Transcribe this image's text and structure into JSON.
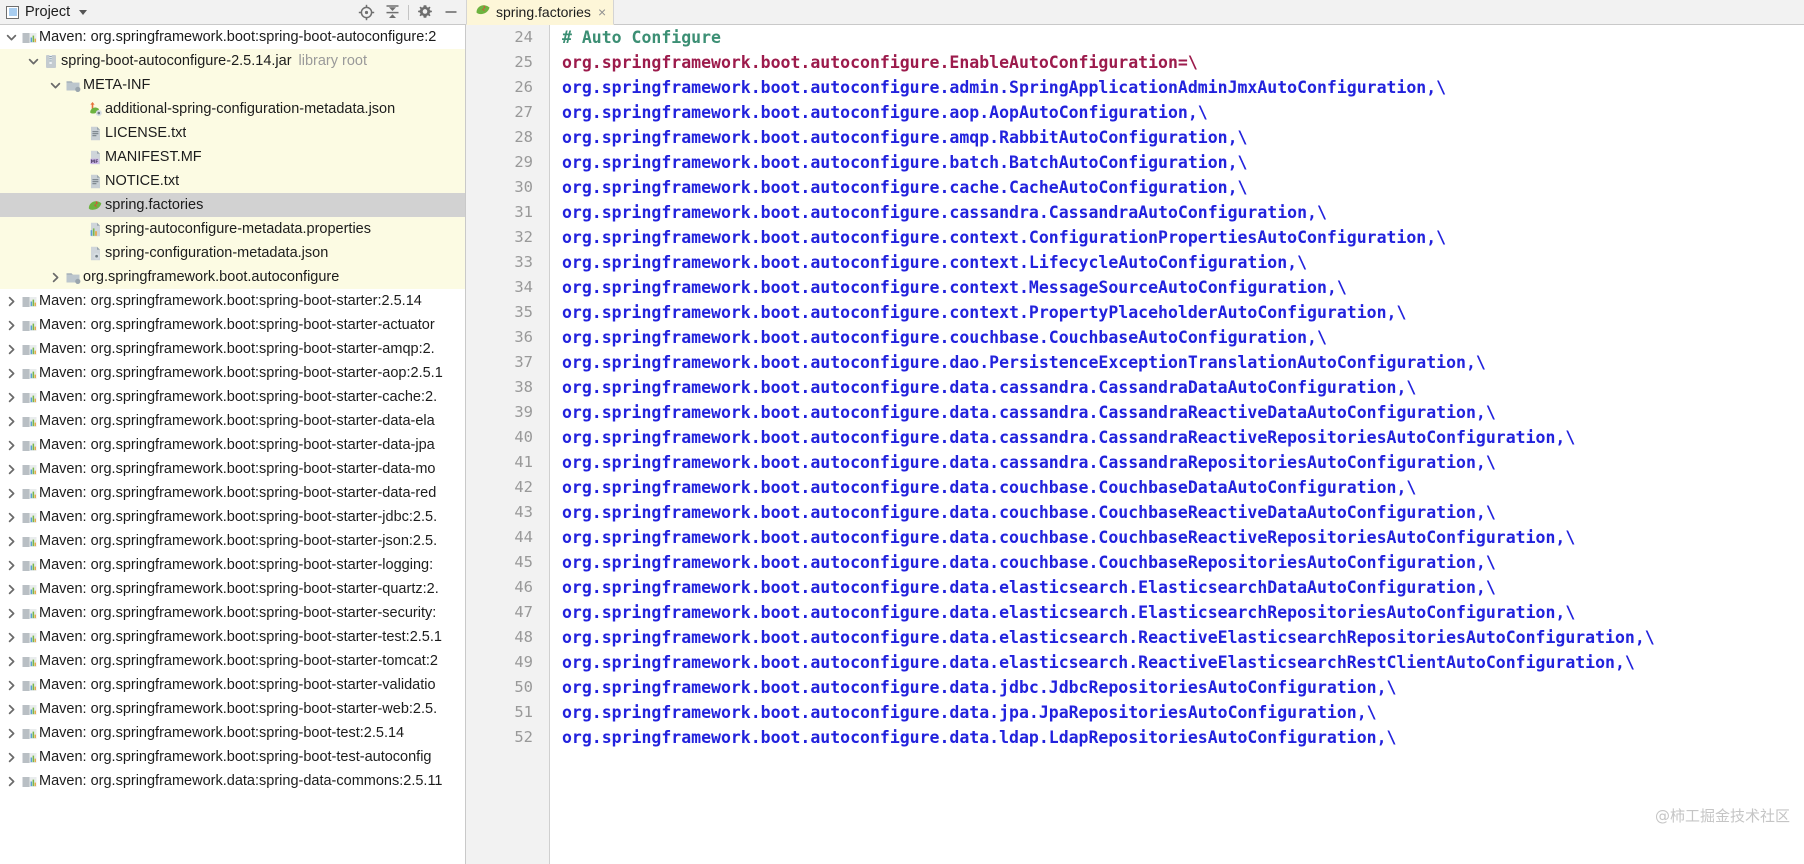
{
  "toolwindow": {
    "title": "Project",
    "dropdown_icon": "chevron-down-icon",
    "panel_icon": "project-panel-icon",
    "actions": [
      {
        "name": "locate-icon",
        "tooltip": "Select Opened File"
      },
      {
        "name": "collapse-all-icon",
        "tooltip": "Collapse All"
      },
      {
        "name": "gear-icon",
        "tooltip": "Settings"
      },
      {
        "name": "hide-icon",
        "tooltip": "Hide"
      }
    ]
  },
  "editor_tabs": [
    {
      "label": "spring.factories",
      "icon": "spring-leaf-icon",
      "close": "×",
      "active": true
    }
  ],
  "tree": [
    {
      "indent": 1,
      "arrow": "down",
      "icon": "maven-icon",
      "label": "Maven: org.springframework.boot:spring-boot-autoconfigure:2",
      "dim": "",
      "state": "normal"
    },
    {
      "indent": 2,
      "arrow": "down",
      "icon": "jar-icon",
      "label": "spring-boot-autoconfigure-2.5.14.jar",
      "dim": "library root",
      "state": "lib"
    },
    {
      "indent": 3,
      "arrow": "down",
      "icon": "folder-icon",
      "label": "META-INF",
      "dim": "",
      "state": "lib"
    },
    {
      "indent": 4,
      "arrow": "none",
      "icon": "spring-config-icon",
      "label": "additional-spring-configuration-metadata.json",
      "dim": "",
      "state": "lib"
    },
    {
      "indent": 4,
      "arrow": "none",
      "icon": "text-file-icon",
      "label": "LICENSE.txt",
      "dim": "",
      "state": "lib"
    },
    {
      "indent": 4,
      "arrow": "none",
      "icon": "manifest-icon",
      "label": "MANIFEST.MF",
      "dim": "",
      "state": "lib"
    },
    {
      "indent": 4,
      "arrow": "none",
      "icon": "text-file-icon",
      "label": "NOTICE.txt",
      "dim": "",
      "state": "lib"
    },
    {
      "indent": 4,
      "arrow": "none",
      "icon": "spring-leaf-icon",
      "label": "spring.factories",
      "dim": "",
      "state": "selected"
    },
    {
      "indent": 4,
      "arrow": "none",
      "icon": "properties-icon",
      "label": "spring-autoconfigure-metadata.properties",
      "dim": "",
      "state": "lib"
    },
    {
      "indent": 4,
      "arrow": "none",
      "icon": "json-icon",
      "label": "spring-configuration-metadata.json",
      "dim": "",
      "state": "lib"
    },
    {
      "indent": 3,
      "arrow": "right",
      "icon": "folder-icon",
      "label": "org.springframework.boot.autoconfigure",
      "dim": "",
      "state": "lib"
    },
    {
      "indent": 1,
      "arrow": "right",
      "icon": "maven-icon",
      "label": "Maven: org.springframework.boot:spring-boot-starter:2.5.14",
      "dim": "",
      "state": "normal"
    },
    {
      "indent": 1,
      "arrow": "right",
      "icon": "maven-icon",
      "label": "Maven: org.springframework.boot:spring-boot-starter-actuator",
      "dim": "",
      "state": "normal"
    },
    {
      "indent": 1,
      "arrow": "right",
      "icon": "maven-icon",
      "label": "Maven: org.springframework.boot:spring-boot-starter-amqp:2.",
      "dim": "",
      "state": "normal"
    },
    {
      "indent": 1,
      "arrow": "right",
      "icon": "maven-icon",
      "label": "Maven: org.springframework.boot:spring-boot-starter-aop:2.5.1",
      "dim": "",
      "state": "normal"
    },
    {
      "indent": 1,
      "arrow": "right",
      "icon": "maven-icon",
      "label": "Maven: org.springframework.boot:spring-boot-starter-cache:2.",
      "dim": "",
      "state": "normal"
    },
    {
      "indent": 1,
      "arrow": "right",
      "icon": "maven-icon",
      "label": "Maven: org.springframework.boot:spring-boot-starter-data-ela",
      "dim": "",
      "state": "normal"
    },
    {
      "indent": 1,
      "arrow": "right",
      "icon": "maven-icon",
      "label": "Maven: org.springframework.boot:spring-boot-starter-data-jpa",
      "dim": "",
      "state": "normal"
    },
    {
      "indent": 1,
      "arrow": "right",
      "icon": "maven-icon",
      "label": "Maven: org.springframework.boot:spring-boot-starter-data-mo",
      "dim": "",
      "state": "normal"
    },
    {
      "indent": 1,
      "arrow": "right",
      "icon": "maven-icon",
      "label": "Maven: org.springframework.boot:spring-boot-starter-data-red",
      "dim": "",
      "state": "normal"
    },
    {
      "indent": 1,
      "arrow": "right",
      "icon": "maven-icon",
      "label": "Maven: org.springframework.boot:spring-boot-starter-jdbc:2.5.",
      "dim": "",
      "state": "normal"
    },
    {
      "indent": 1,
      "arrow": "right",
      "icon": "maven-icon",
      "label": "Maven: org.springframework.boot:spring-boot-starter-json:2.5.",
      "dim": "",
      "state": "normal"
    },
    {
      "indent": 1,
      "arrow": "right",
      "icon": "maven-icon",
      "label": "Maven: org.springframework.boot:spring-boot-starter-logging:",
      "dim": "",
      "state": "normal"
    },
    {
      "indent": 1,
      "arrow": "right",
      "icon": "maven-icon",
      "label": "Maven: org.springframework.boot:spring-boot-starter-quartz:2.",
      "dim": "",
      "state": "normal"
    },
    {
      "indent": 1,
      "arrow": "right",
      "icon": "maven-icon",
      "label": "Maven: org.springframework.boot:spring-boot-starter-security:",
      "dim": "",
      "state": "normal"
    },
    {
      "indent": 1,
      "arrow": "right",
      "icon": "maven-icon",
      "label": "Maven: org.springframework.boot:spring-boot-starter-test:2.5.1",
      "dim": "",
      "state": "normal"
    },
    {
      "indent": 1,
      "arrow": "right",
      "icon": "maven-icon",
      "label": "Maven: org.springframework.boot:spring-boot-starter-tomcat:2",
      "dim": "",
      "state": "normal"
    },
    {
      "indent": 1,
      "arrow": "right",
      "icon": "maven-icon",
      "label": "Maven: org.springframework.boot:spring-boot-starter-validatio",
      "dim": "",
      "state": "normal"
    },
    {
      "indent": 1,
      "arrow": "right",
      "icon": "maven-icon",
      "label": "Maven: org.springframework.boot:spring-boot-starter-web:2.5.",
      "dim": "",
      "state": "normal"
    },
    {
      "indent": 1,
      "arrow": "right",
      "icon": "maven-icon",
      "label": "Maven: org.springframework.boot:spring-boot-test:2.5.14",
      "dim": "",
      "state": "normal"
    },
    {
      "indent": 1,
      "arrow": "right",
      "icon": "maven-icon",
      "label": "Maven: org.springframework.boot:spring-boot-test-autoconfig",
      "dim": "",
      "state": "normal"
    },
    {
      "indent": 1,
      "arrow": "right",
      "icon": "maven-icon",
      "label": "Maven: org.springframework.data:spring-data-commons:2.5.11",
      "dim": "",
      "state": "normal"
    }
  ],
  "code": {
    "first_line_number": 24,
    "lines": [
      {
        "n": 24,
        "type": "comment",
        "text": "# Auto Configure"
      },
      {
        "n": 25,
        "type": "key",
        "text": "org.springframework.boot.autoconfigure.EnableAutoConfiguration=\\"
      },
      {
        "n": 26,
        "type": "value",
        "text": "org.springframework.boot.autoconfigure.admin.SpringApplicationAdminJmxAutoConfiguration,\\"
      },
      {
        "n": 27,
        "type": "value",
        "text": "org.springframework.boot.autoconfigure.aop.AopAutoConfiguration,\\"
      },
      {
        "n": 28,
        "type": "value",
        "text": "org.springframework.boot.autoconfigure.amqp.RabbitAutoConfiguration,\\"
      },
      {
        "n": 29,
        "type": "value",
        "text": "org.springframework.boot.autoconfigure.batch.BatchAutoConfiguration,\\"
      },
      {
        "n": 30,
        "type": "value",
        "text": "org.springframework.boot.autoconfigure.cache.CacheAutoConfiguration,\\"
      },
      {
        "n": 31,
        "type": "value",
        "text": "org.springframework.boot.autoconfigure.cassandra.CassandraAutoConfiguration,\\"
      },
      {
        "n": 32,
        "type": "value",
        "text": "org.springframework.boot.autoconfigure.context.ConfigurationPropertiesAutoConfiguration,\\"
      },
      {
        "n": 33,
        "type": "value",
        "text": "org.springframework.boot.autoconfigure.context.LifecycleAutoConfiguration,\\"
      },
      {
        "n": 34,
        "type": "value",
        "text": "org.springframework.boot.autoconfigure.context.MessageSourceAutoConfiguration,\\"
      },
      {
        "n": 35,
        "type": "value",
        "text": "org.springframework.boot.autoconfigure.context.PropertyPlaceholderAutoConfiguration,\\"
      },
      {
        "n": 36,
        "type": "value",
        "text": "org.springframework.boot.autoconfigure.couchbase.CouchbaseAutoConfiguration,\\"
      },
      {
        "n": 37,
        "type": "value",
        "text": "org.springframework.boot.autoconfigure.dao.PersistenceExceptionTranslationAutoConfiguration,\\"
      },
      {
        "n": 38,
        "type": "value",
        "text": "org.springframework.boot.autoconfigure.data.cassandra.CassandraDataAutoConfiguration,\\"
      },
      {
        "n": 39,
        "type": "value",
        "text": "org.springframework.boot.autoconfigure.data.cassandra.CassandraReactiveDataAutoConfiguration,\\"
      },
      {
        "n": 40,
        "type": "value",
        "text": "org.springframework.boot.autoconfigure.data.cassandra.CassandraReactiveRepositoriesAutoConfiguration,\\"
      },
      {
        "n": 41,
        "type": "value",
        "text": "org.springframework.boot.autoconfigure.data.cassandra.CassandraRepositoriesAutoConfiguration,\\"
      },
      {
        "n": 42,
        "type": "value",
        "text": "org.springframework.boot.autoconfigure.data.couchbase.CouchbaseDataAutoConfiguration,\\"
      },
      {
        "n": 43,
        "type": "value",
        "text": "org.springframework.boot.autoconfigure.data.couchbase.CouchbaseReactiveDataAutoConfiguration,\\"
      },
      {
        "n": 44,
        "type": "value",
        "text": "org.springframework.boot.autoconfigure.data.couchbase.CouchbaseReactiveRepositoriesAutoConfiguration,\\"
      },
      {
        "n": 45,
        "type": "value",
        "text": "org.springframework.boot.autoconfigure.data.couchbase.CouchbaseRepositoriesAutoConfiguration,\\"
      },
      {
        "n": 46,
        "type": "value",
        "text": "org.springframework.boot.autoconfigure.data.elasticsearch.ElasticsearchDataAutoConfiguration,\\"
      },
      {
        "n": 47,
        "type": "value",
        "text": "org.springframework.boot.autoconfigure.data.elasticsearch.ElasticsearchRepositoriesAutoConfiguration,\\"
      },
      {
        "n": 48,
        "type": "value",
        "text": "org.springframework.boot.autoconfigure.data.elasticsearch.ReactiveElasticsearchRepositoriesAutoConfiguration,\\"
      },
      {
        "n": 49,
        "type": "value",
        "text": "org.springframework.boot.autoconfigure.data.elasticsearch.ReactiveElasticsearchRestClientAutoConfiguration,\\"
      },
      {
        "n": 50,
        "type": "value",
        "text": "org.springframework.boot.autoconfigure.data.jdbc.JdbcRepositoriesAutoConfiguration,\\"
      },
      {
        "n": 51,
        "type": "value",
        "text": "org.springframework.boot.autoconfigure.data.jpa.JpaRepositoriesAutoConfiguration,\\"
      },
      {
        "n": 52,
        "type": "value",
        "text": "org.springframework.boot.autoconfigure.data.ldap.LdapRepositoriesAutoConfiguration,\\"
      }
    ]
  },
  "watermark": "@柿工掘金技术社区",
  "colors": {
    "comment": "#3c8f74",
    "key": "#9c1b4c",
    "value": "#2222dd",
    "library_row_bg": "#fcfbe3",
    "selected_row_bg": "#d2d2d2",
    "tab_bg": "#fdf6d8",
    "gutter_bg": "#f2f2f2"
  }
}
